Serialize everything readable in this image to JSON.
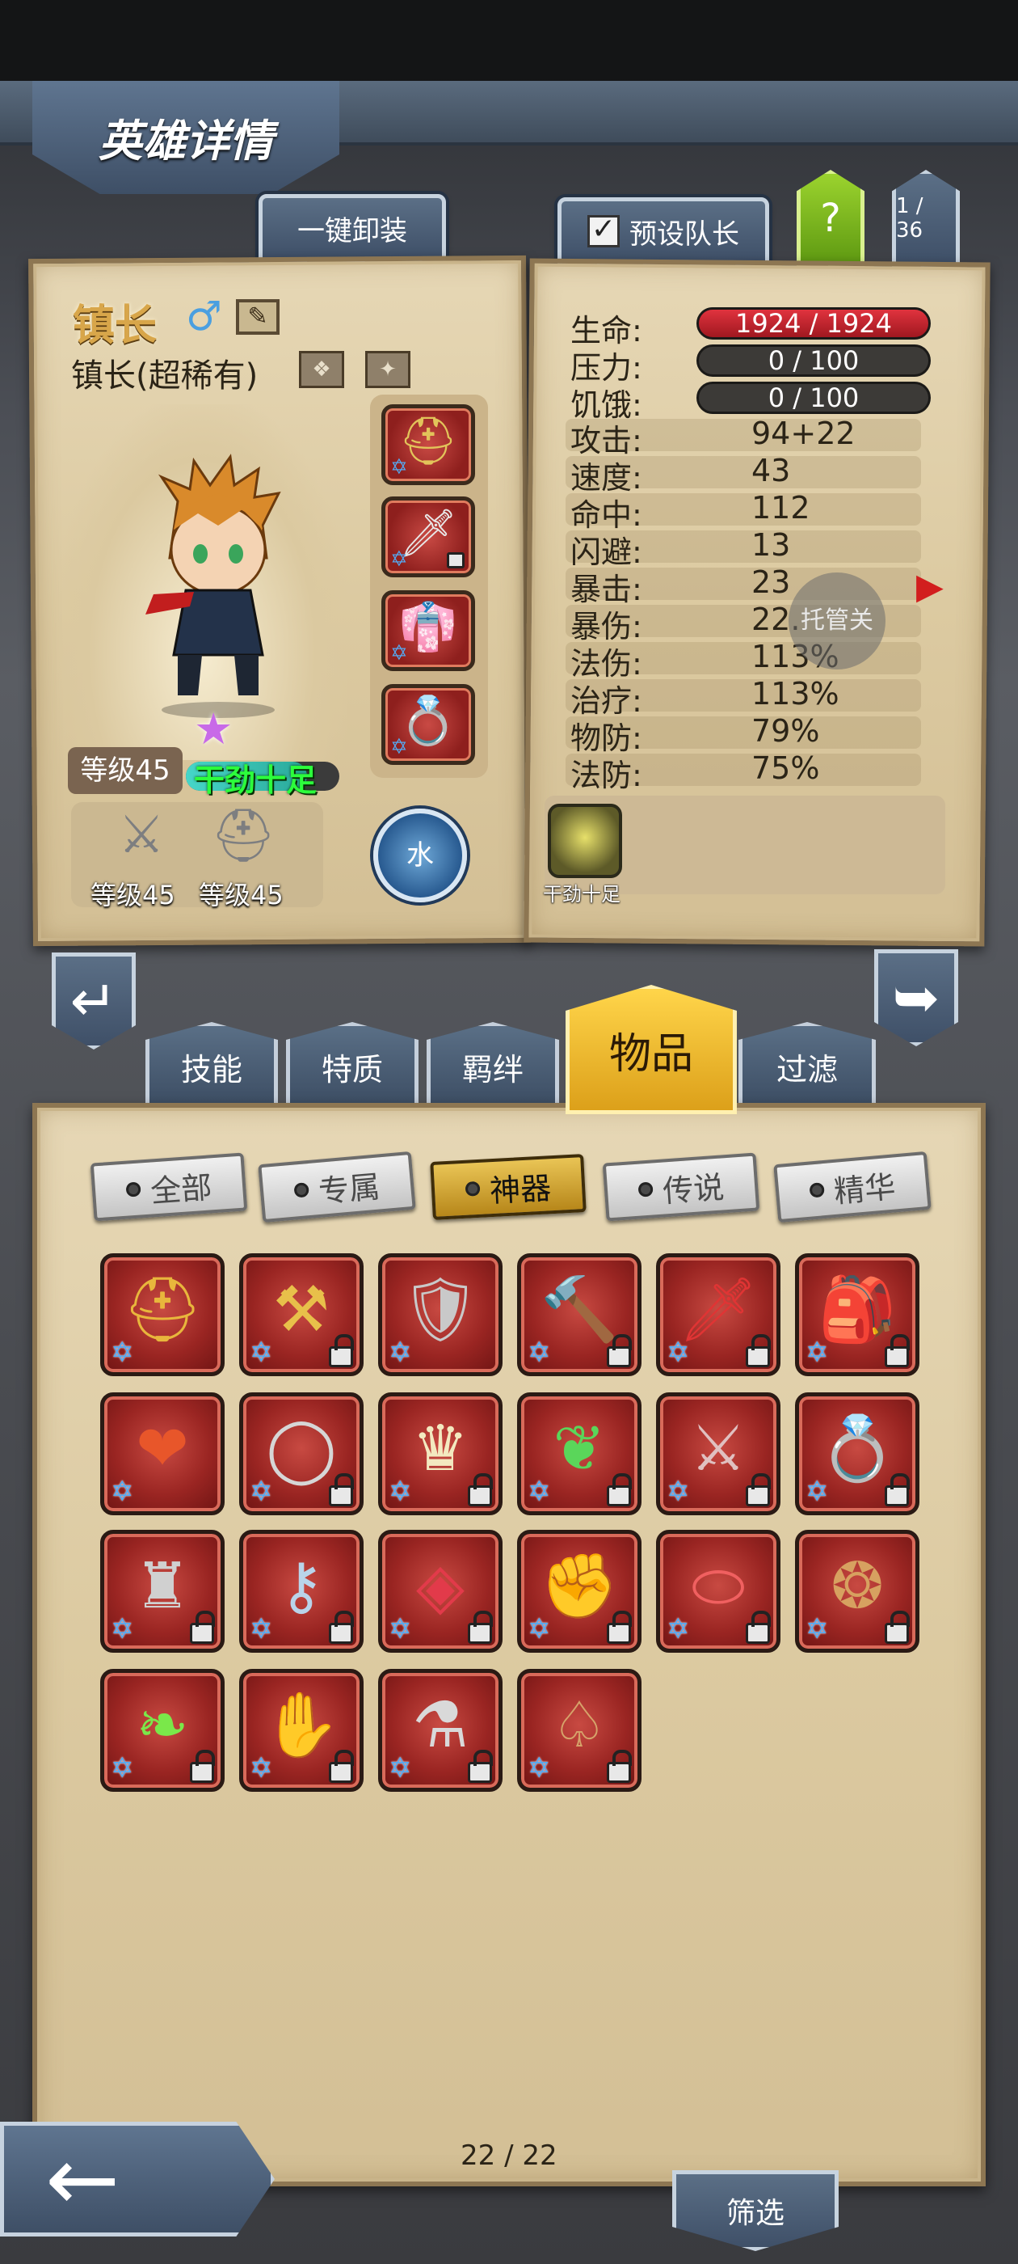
{
  "header": {
    "title": "英雄详情"
  },
  "top_buttons": {
    "unequip_all": "一键卸装",
    "preset_captain": "预设队长",
    "preset_captain_checked": true,
    "help": "?",
    "page": "1 / 36"
  },
  "hero": {
    "name": "镇长",
    "gender_symbol": "♂",
    "class": "镇长(超稀有)",
    "level": "等级45",
    "mood": "干劲十足",
    "element": "水",
    "weapon_level": "等级45",
    "helmet_level": "等级45",
    "gear_slots": [
      "helmet-icon",
      "dagger-icon",
      "armor-icon",
      "ring-icon"
    ]
  },
  "stats": {
    "hp_label": "生命:",
    "hp_value": "1924 / 1924",
    "stress_label": "压力:",
    "stress_value": "0 / 100",
    "hunger_label": "饥饿:",
    "hunger_value": "0 / 100",
    "rows": [
      {
        "label": "攻击:",
        "value": "94+22"
      },
      {
        "label": "速度:",
        "value": "43"
      },
      {
        "label": "命中:",
        "value": "112"
      },
      {
        "label": "闪避:",
        "value": "13"
      },
      {
        "label": "暴击:",
        "value": "23"
      },
      {
        "label": "暴伤:",
        "value": "22."
      },
      {
        "label": "法伤:",
        "value": "113%"
      },
      {
        "label": "治疗:",
        "value": "113%"
      },
      {
        "label": "物防:",
        "value": "79%"
      },
      {
        "label": "法防:",
        "value": "75%"
      }
    ],
    "auto_button": "托管关",
    "trait_label": "干劲十足"
  },
  "category_tabs": {
    "skills": "技能",
    "traits": "特质",
    "bonds": "羁绊",
    "items": "物品",
    "filter": "过滤"
  },
  "rarity_tabs": {
    "all": "全部",
    "exclusive": "专属",
    "artifact": "神器",
    "legend": "传说",
    "essence": "精华",
    "active": "神器"
  },
  "items": [
    {
      "icon": "hood-icon",
      "glyph": "⛑",
      "locked": false
    },
    {
      "icon": "axe-icon",
      "glyph": "⚒",
      "locked": true
    },
    {
      "icon": "shield-icon",
      "glyph": "🛡",
      "locked": false
    },
    {
      "icon": "hammer-icon",
      "glyph": "🔨",
      "locked": true
    },
    {
      "icon": "blade-icon",
      "glyph": "🗡",
      "locked": true
    },
    {
      "icon": "bag-icon",
      "glyph": "🎒",
      "locked": true
    },
    {
      "icon": "heart-icon",
      "glyph": "❤",
      "locked": false
    },
    {
      "icon": "bracelet-icon",
      "glyph": "◯",
      "locked": true
    },
    {
      "icon": "crown-icon",
      "glyph": "♛",
      "locked": true
    },
    {
      "icon": "leaf-icon",
      "glyph": "❦",
      "locked": true
    },
    {
      "icon": "battleaxe-icon",
      "glyph": "⚔",
      "locked": true
    },
    {
      "icon": "gem-ring-icon",
      "glyph": "💍",
      "locked": true
    },
    {
      "icon": "horned-helm-icon",
      "glyph": "♜",
      "locked": true
    },
    {
      "icon": "key-staff-icon",
      "glyph": "⚷",
      "locked": true
    },
    {
      "icon": "amulet-icon",
      "glyph": "◈",
      "locked": true
    },
    {
      "icon": "gauntlet-icon",
      "glyph": "✊",
      "locked": true
    },
    {
      "icon": "red-cloth-icon",
      "glyph": "⬭",
      "locked": true
    },
    {
      "icon": "cookie-ring-icon",
      "glyph": "❂",
      "locked": true
    },
    {
      "icon": "vine-icon",
      "glyph": "❧",
      "locked": true
    },
    {
      "icon": "glove-icon",
      "glyph": "✋",
      "locked": true
    },
    {
      "icon": "lantern-icon",
      "glyph": "⚗",
      "locked": true
    },
    {
      "icon": "cloak-icon",
      "glyph": "♤",
      "locked": true
    }
  ],
  "footer": {
    "page_count": "22 / 22",
    "filter": "筛选",
    "back": "←"
  },
  "colors": {
    "accent_gold": "#dca01a",
    "slate": "#3f5068",
    "parchment": "#dccaa1",
    "item_red": "#9a2522",
    "hp_red": "#e0333e"
  }
}
